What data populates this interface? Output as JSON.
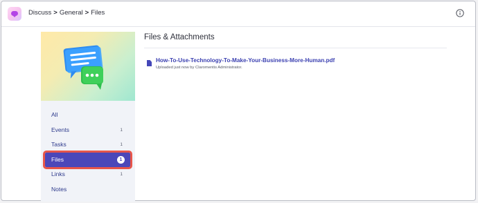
{
  "header": {
    "breadcrumb": [
      "Discuss",
      "General",
      "Files"
    ],
    "separator": ">",
    "logo_icon": "chat-bubble-icon",
    "info_icon": "info-icon"
  },
  "sidebar": {
    "hero_icon": "chat-bubbles-illustration",
    "items": [
      {
        "label": "All",
        "count": ""
      },
      {
        "label": "Events",
        "count": "1"
      },
      {
        "label": "Tasks",
        "count": "1"
      },
      {
        "label": "Files",
        "count": "1",
        "active": true
      },
      {
        "label": "Links",
        "count": "1"
      },
      {
        "label": "Notes",
        "count": ""
      }
    ]
  },
  "main": {
    "title": "Files & Attachments",
    "files": [
      {
        "name": "How-To-Use-Technology-To-Make-Your-Business-More-Human.pdf",
        "meta": "Uploaded just now by Claromentis Administrator.",
        "icon": "document-icon"
      }
    ]
  },
  "colors": {
    "accent": "#4b47b9",
    "highlight_outline": "#e7564a",
    "link": "#3a3fb0",
    "sidebar_bg": "#f1f3f8"
  }
}
